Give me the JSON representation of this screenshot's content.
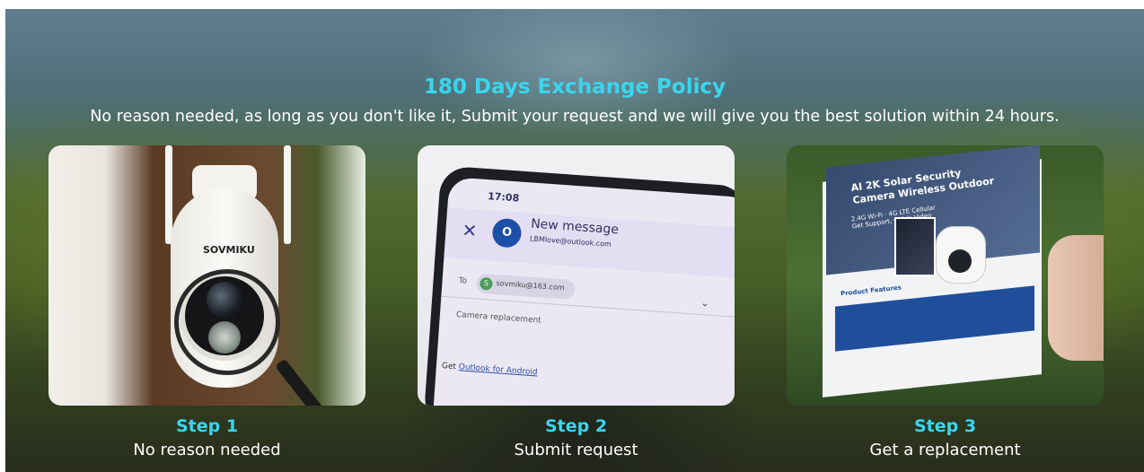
{
  "banner": {
    "headline": "180 Days Exchange Policy",
    "subline": "No reason needed, as long as you don't like it, Submit your request and we will give you the best solution within 24 hours.",
    "accent_color": "#3ad6ee"
  },
  "steps": [
    {
      "title": "Step 1",
      "description": "No reason needed",
      "image": "security-camera-magnifier"
    },
    {
      "title": "Step 2",
      "description": "Submit request",
      "image": "phone-email-compose"
    },
    {
      "title": "Step 3",
      "description": "Get a replacement",
      "image": "product-box"
    }
  ],
  "camera": {
    "brand": "SOVMIKU"
  },
  "phone": {
    "time": "17:08",
    "compose_title": "New message",
    "from": "LBMlove@outlook.com",
    "to_label": "To",
    "recipient_initial": "S",
    "recipient": "sovmiku@163.com",
    "subject": "Camera replacement",
    "signature_prefix": "Get ",
    "signature_link": "Outlook for Android"
  },
  "box": {
    "title_line1": "AI 2K Solar Security",
    "title_line2": "Camera Wireless Outdoor",
    "sub": "2.4G Wi-Fi  ·  4G LTE Cellular",
    "support": "Get Support, Guide Video",
    "features_label": "Product Features"
  }
}
